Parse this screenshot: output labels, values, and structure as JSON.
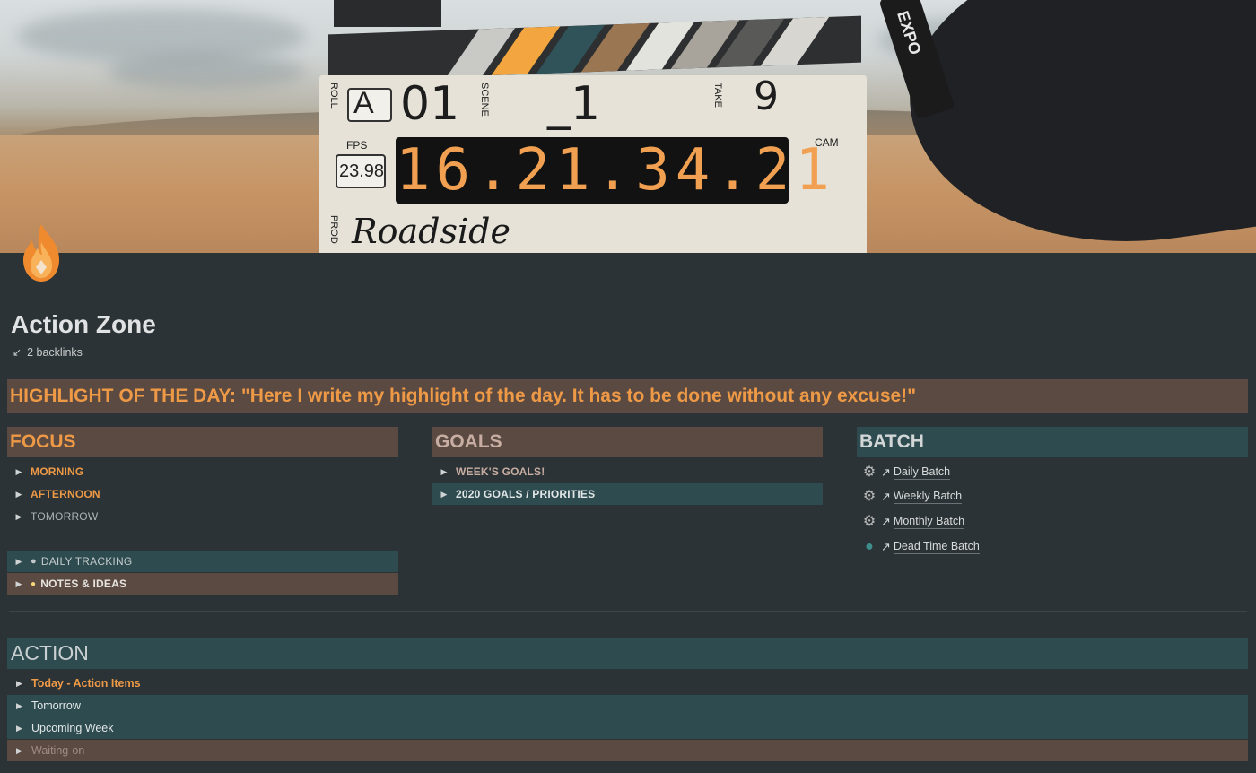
{
  "cover": {
    "clapperboard": {
      "roll_label": "ROLL",
      "roll_value": "A",
      "scene_label": "SCENE",
      "scene_prefix": "01",
      "scene_value": "_1",
      "take_label": "TAKE",
      "take_value": "9",
      "fps_label": "FPS",
      "fps_value": "23.98",
      "cam_label": "CAM",
      "timecode": "16.21.34.21",
      "prod_label": "PROD",
      "production": "Roadside",
      "marker_text": "EXPO"
    }
  },
  "page": {
    "icon": "fire-icon",
    "title": "Action Zone",
    "backlinks": "2 backlinks"
  },
  "highlight": {
    "text": "HIGHLIGHT OF THE DAY: \"Here I write my highlight of the day. It has to be done without any excuse!\""
  },
  "focus": {
    "heading": "FOCUS",
    "items": [
      {
        "label": "MORNING"
      },
      {
        "label": "AFTERNOON"
      },
      {
        "label": "TOMORROW"
      }
    ],
    "tracking": {
      "icon": "apple-icon",
      "label": "DAILY TRACKING"
    },
    "notes": {
      "icon": "lightbulb-icon",
      "label": "NOTES & IDEAS"
    }
  },
  "goals": {
    "heading": "GOALS",
    "items": [
      {
        "label": "WEEK'S GOALS!"
      },
      {
        "label": "2020 GOALS / PRIORITIES"
      }
    ]
  },
  "batch": {
    "heading": "BATCH",
    "links": [
      {
        "icon": "gear-icon",
        "label": "Daily Batch"
      },
      {
        "icon": "gear-icon",
        "label": "Weekly Batch"
      },
      {
        "icon": "gear-icon",
        "label": "Monthly Batch"
      },
      {
        "icon": "globe-icon",
        "label": "Dead Time Batch"
      }
    ]
  },
  "action": {
    "heading": "ACTION",
    "items": [
      {
        "label": "Today - Action Items"
      },
      {
        "label": "Tomorrow"
      },
      {
        "label": "Upcoming Week"
      },
      {
        "label": "Waiting-on"
      }
    ]
  },
  "colors": {
    "background": "#2b3336",
    "orange": "#ee9946",
    "brown_block": "#5a4a42",
    "teal_block": "#2e4c50"
  }
}
